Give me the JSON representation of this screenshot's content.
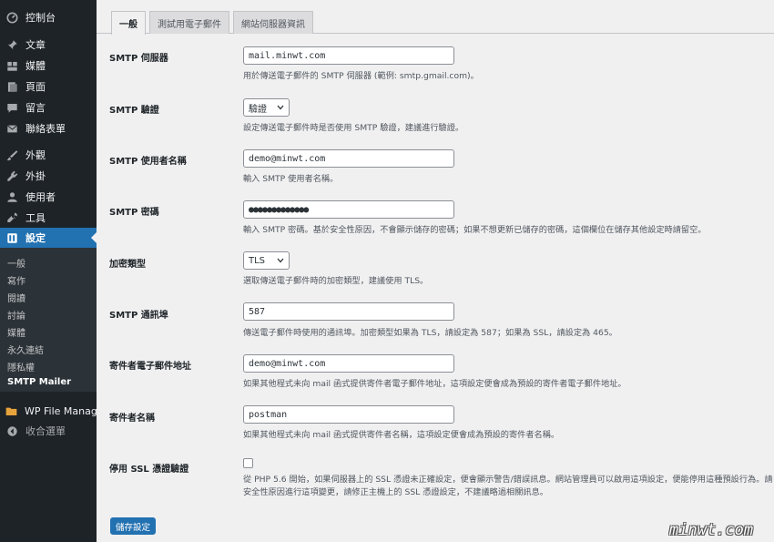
{
  "sidebar": {
    "items": [
      {
        "label": "控制台",
        "icon": "dashboard-icon"
      },
      {
        "label": "文章",
        "icon": "pin-icon"
      },
      {
        "label": "媒體",
        "icon": "media-icon"
      },
      {
        "label": "頁面",
        "icon": "page-icon"
      },
      {
        "label": "留言",
        "icon": "comment-icon"
      },
      {
        "label": "聯絡表單",
        "icon": "mail-icon"
      },
      {
        "label": "外觀",
        "icon": "brush-icon"
      },
      {
        "label": "外掛",
        "icon": "plugin-icon"
      },
      {
        "label": "使用者",
        "icon": "user-icon"
      },
      {
        "label": "工具",
        "icon": "wrench-icon"
      },
      {
        "label": "設定",
        "icon": "settings-icon"
      }
    ],
    "submenu": [
      "一般",
      "寫作",
      "閱讀",
      "討論",
      "媒體",
      "永久連結",
      "隱私權",
      "SMTP Mailer"
    ],
    "extra": [
      {
        "label": "WP File Manager",
        "icon": "folder-icon"
      },
      {
        "label": "收合選單",
        "icon": "collapse-icon"
      }
    ]
  },
  "tabs": [
    "一般",
    "測試用電子郵件",
    "網站伺服器資訊"
  ],
  "fields": {
    "host": {
      "label": "SMTP 伺服器",
      "value": "mail.minwt.com",
      "desc": "用於傳送電子郵件的 SMTP 伺服器 (範例: smtp.gmail.com)。"
    },
    "auth": {
      "label": "SMTP 驗證",
      "value": "驗證",
      "desc": "設定傳送電子郵件時是否使用 SMTP 驗證，建議進行驗證。"
    },
    "username": {
      "label": "SMTP 使用者名稱",
      "value": "demo@minwt.com",
      "desc": "輸入 SMTP 使用者名稱。"
    },
    "password": {
      "label": "SMTP 密碼",
      "value": "●●●●●●●●●●●●●",
      "desc": "輸入 SMTP 密碼。基於安全性原因，不會顯示儲存的密碼；如果不想更新已儲存的密碼，這個欄位在儲存其他設定時請留空。"
    },
    "encryption": {
      "label": "加密類型",
      "value": "TLS",
      "desc": "選取傳送電子郵件時的加密類型，建議使用 TLS。"
    },
    "port": {
      "label": "SMTP 通訊埠",
      "value": "587",
      "desc": "傳送電子郵件時使用的通訊埠。加密類型如果為 TLS，請設定為 587；如果為 SSL，請設定為 465。"
    },
    "from_email": {
      "label": "寄件者電子郵件地址",
      "value": "demo@minwt.com",
      "desc": "如果其他程式未向 mail 函式提供寄件者電子郵件地址，這項設定便會成為預設的寄件者電子郵件地址。"
    },
    "from_name": {
      "label": "寄件者名稱",
      "value": "postman",
      "desc": "如果其他程式未向 mail 函式提供寄件者名稱，這項設定便會成為預設的寄件者名稱。"
    },
    "ssl": {
      "label": "停用 SSL 憑證驗證",
      "desc1": "從 PHP 5.6 開始，如果伺服器上的 SSL 憑證未正確設定，便會顯示警告/錯誤訊息。網站管理員可以啟用這項設定，便能停用這種預設行為。請",
      "desc2": "安全性原因進行這項變更，請修正主機上的 SSL 憑證設定，不建議略過相關訊息。"
    }
  },
  "save_label": "儲存設定",
  "watermark": "minwt.com",
  "colors": {
    "sidebar": "#1d2327",
    "accent": "#2271b1",
    "background": "#f0f0f1"
  }
}
